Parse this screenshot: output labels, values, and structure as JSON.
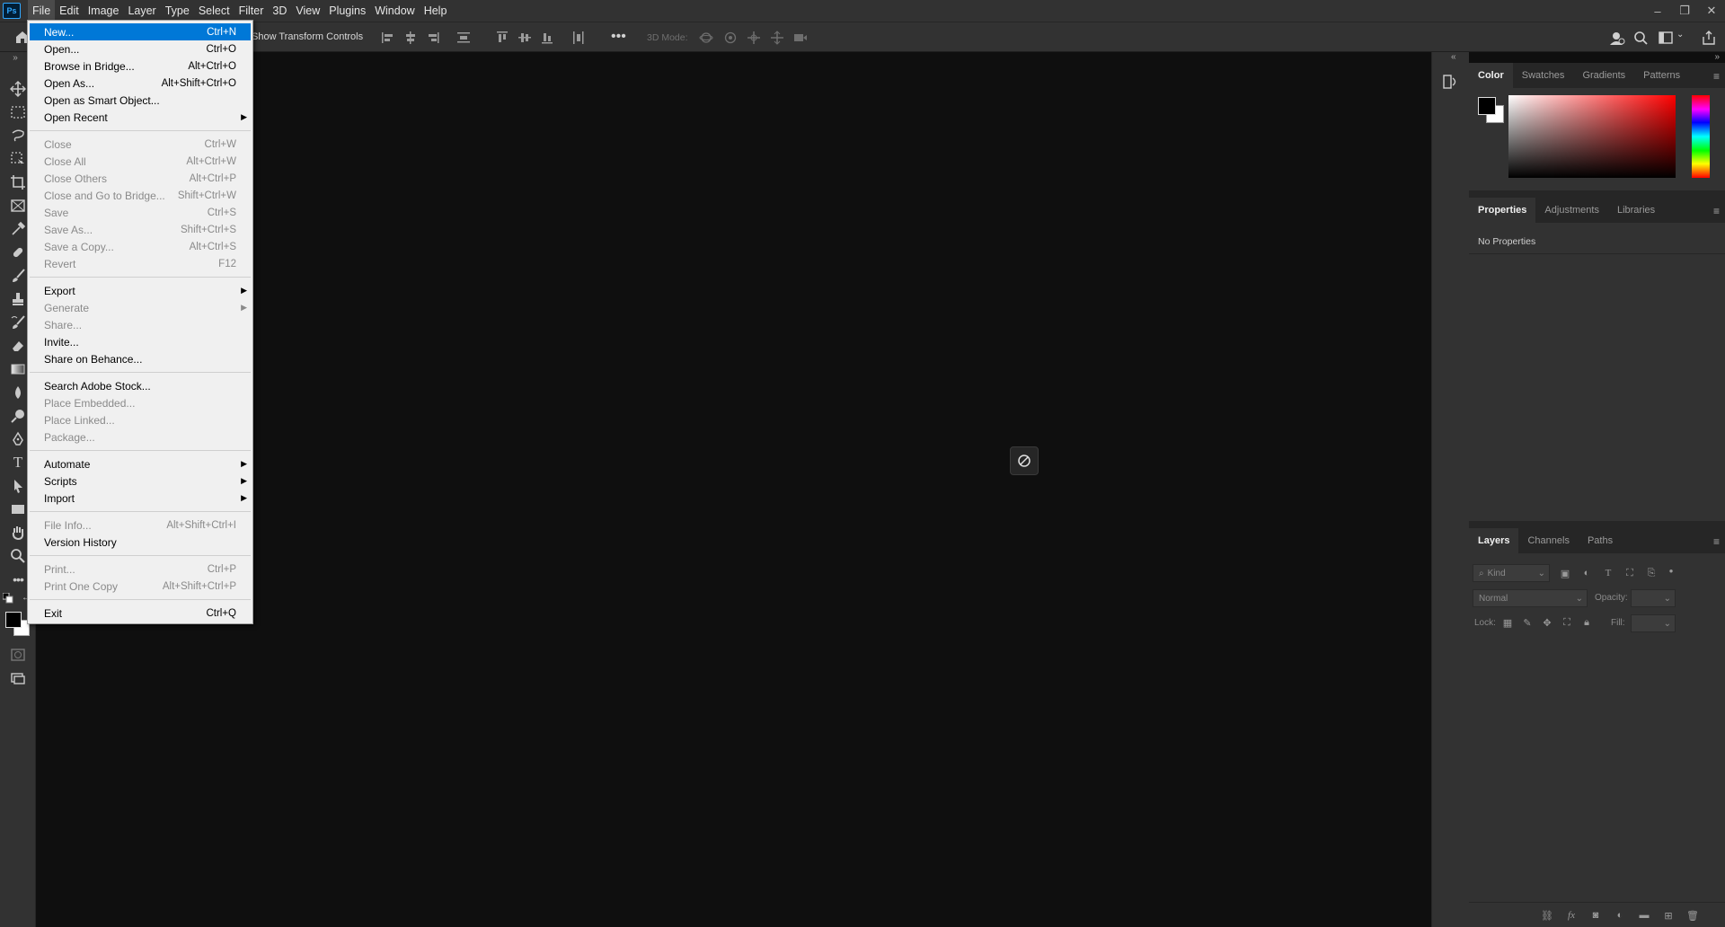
{
  "app": {
    "logo": "Ps"
  },
  "menubar": {
    "items": [
      "File",
      "Edit",
      "Image",
      "Layer",
      "Type",
      "Select",
      "Filter",
      "3D",
      "View",
      "Plugins",
      "Window",
      "Help"
    ]
  },
  "window_controls": {
    "minimize": "‒",
    "restore": "❐",
    "close": "✕"
  },
  "options_bar": {
    "show_transform_controls": "Show Transform Controls",
    "mode_3d": "3D Mode:"
  },
  "file_menu": {
    "items": [
      {
        "label": "New...",
        "shortcut": "Ctrl+N",
        "state": "selected"
      },
      {
        "label": "Open...",
        "shortcut": "Ctrl+O",
        "state": "enabled"
      },
      {
        "label": "Browse in Bridge...",
        "shortcut": "Alt+Ctrl+O",
        "state": "enabled"
      },
      {
        "label": "Open As...",
        "shortcut": "Alt+Shift+Ctrl+O",
        "state": "enabled"
      },
      {
        "label": "Open as Smart Object...",
        "shortcut": "",
        "state": "enabled"
      },
      {
        "label": "Open Recent",
        "shortcut": "",
        "state": "enabled",
        "submenu": true
      },
      {
        "label": "Close",
        "shortcut": "Ctrl+W",
        "state": "disabled"
      },
      {
        "label": "Close All",
        "shortcut": "Alt+Ctrl+W",
        "state": "disabled"
      },
      {
        "label": "Close Others",
        "shortcut": "Alt+Ctrl+P",
        "state": "disabled"
      },
      {
        "label": "Close and Go to Bridge...",
        "shortcut": "Shift+Ctrl+W",
        "state": "disabled"
      },
      {
        "label": "Save",
        "shortcut": "Ctrl+S",
        "state": "disabled"
      },
      {
        "label": "Save As...",
        "shortcut": "Shift+Ctrl+S",
        "state": "disabled"
      },
      {
        "label": "Save a Copy...",
        "shortcut": "Alt+Ctrl+S",
        "state": "disabled"
      },
      {
        "label": "Revert",
        "shortcut": "F12",
        "state": "disabled"
      },
      {
        "label": "Export",
        "shortcut": "",
        "state": "enabled",
        "submenu": true
      },
      {
        "label": "Generate",
        "shortcut": "",
        "state": "disabled",
        "submenu": true
      },
      {
        "label": "Share...",
        "shortcut": "",
        "state": "disabled"
      },
      {
        "label": "Invite...",
        "shortcut": "",
        "state": "enabled"
      },
      {
        "label": "Share on Behance...",
        "shortcut": "",
        "state": "enabled"
      },
      {
        "label": "Search Adobe Stock...",
        "shortcut": "",
        "state": "enabled"
      },
      {
        "label": "Place Embedded...",
        "shortcut": "",
        "state": "disabled"
      },
      {
        "label": "Place Linked...",
        "shortcut": "",
        "state": "disabled"
      },
      {
        "label": "Package...",
        "shortcut": "",
        "state": "disabled"
      },
      {
        "label": "Automate",
        "shortcut": "",
        "state": "enabled",
        "submenu": true
      },
      {
        "label": "Scripts",
        "shortcut": "",
        "state": "enabled",
        "submenu": true
      },
      {
        "label": "Import",
        "shortcut": "",
        "state": "enabled",
        "submenu": true
      },
      {
        "label": "File Info...",
        "shortcut": "Alt+Shift+Ctrl+I",
        "state": "disabled"
      },
      {
        "label": "Version History",
        "shortcut": "",
        "state": "enabled"
      },
      {
        "label": "Print...",
        "shortcut": "Ctrl+P",
        "state": "disabled"
      },
      {
        "label": "Print One Copy",
        "shortcut": "Alt+Shift+Ctrl+P",
        "state": "disabled"
      },
      {
        "label": "Exit",
        "shortcut": "Ctrl+Q",
        "state": "enabled"
      }
    ]
  },
  "color_panel": {
    "tabs": [
      "Color",
      "Swatches",
      "Gradients",
      "Patterns"
    ],
    "foreground": "#000000",
    "background": "#ffffff",
    "hue": "#ff0000"
  },
  "properties_panel": {
    "tabs": [
      "Properties",
      "Adjustments",
      "Libraries"
    ],
    "empty_text": "No Properties"
  },
  "layers_panel": {
    "tabs": [
      "Layers",
      "Channels",
      "Paths"
    ],
    "filter_placeholder": "Kind",
    "blend_mode": "Normal",
    "opacity_label": "Opacity:",
    "lock_label": "Lock:",
    "fill_label": "Fill:"
  }
}
